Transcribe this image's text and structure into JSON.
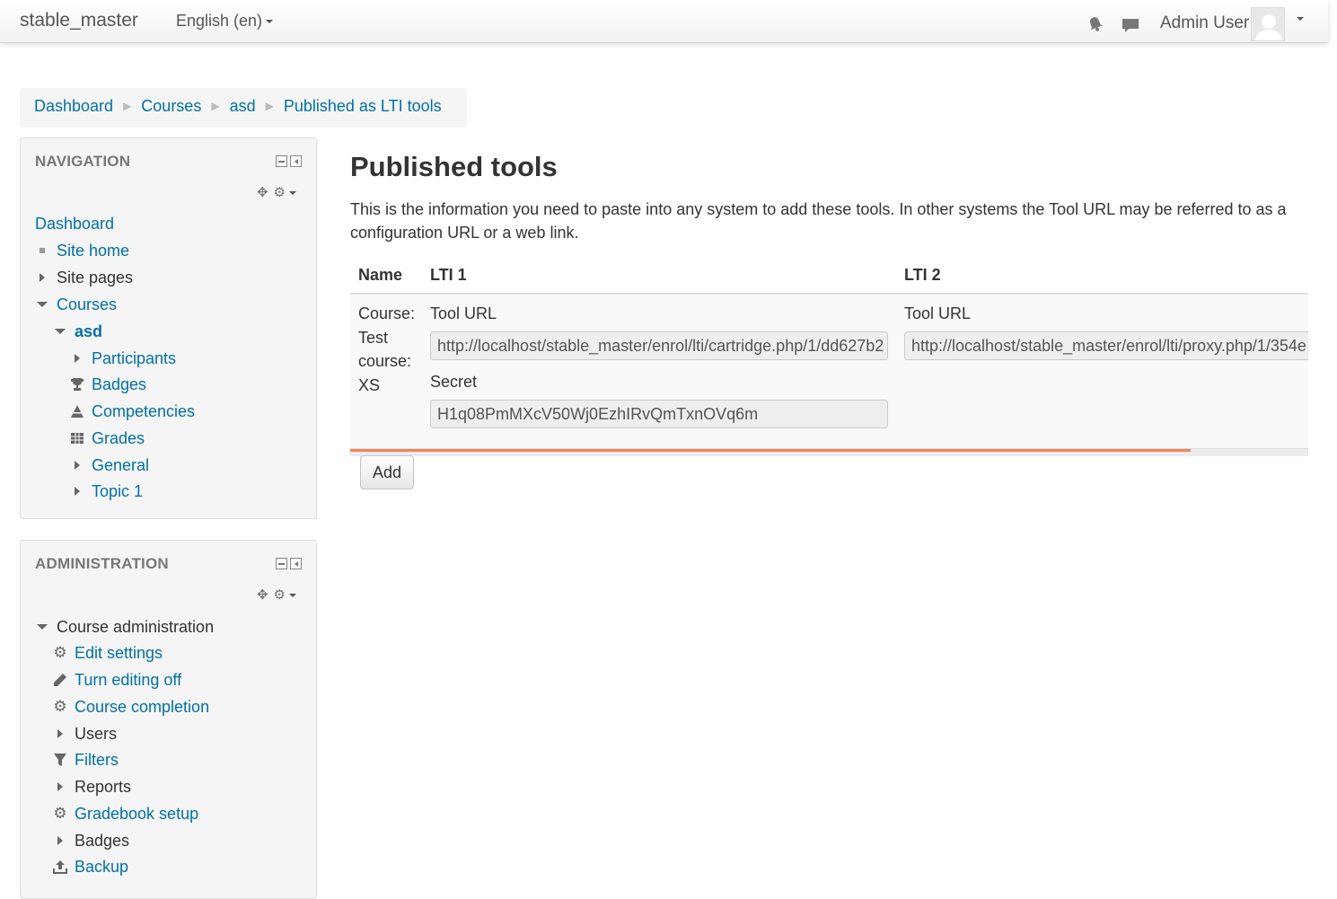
{
  "navbar": {
    "brand": "stable_master",
    "language": "English (en)",
    "username": "Admin User"
  },
  "breadcrumb": [
    "Dashboard",
    "Courses",
    "asd",
    "Published as LTI tools"
  ],
  "navigation_block": {
    "title": "NAVIGATION",
    "items": [
      {
        "label": "Dashboard",
        "icon": "none",
        "link": true
      },
      {
        "label": "Site home",
        "icon": "bullet-icon",
        "link": true
      },
      {
        "label": "Site pages",
        "icon": "expand-icon",
        "link": false
      },
      {
        "label": "Courses",
        "icon": "collapse-icon",
        "link": true
      },
      {
        "label": "asd",
        "icon": "collapse-icon",
        "link": true
      },
      {
        "label": "Participants",
        "icon": "expand-icon",
        "link": true
      },
      {
        "label": "Badges",
        "icon": "trophy-icon",
        "link": true
      },
      {
        "label": "Competencies",
        "icon": "competency-icon",
        "link": true
      },
      {
        "label": "Grades",
        "icon": "table-icon",
        "link": true
      },
      {
        "label": "General",
        "icon": "expand-icon",
        "link": true
      },
      {
        "label": "Topic 1",
        "icon": "expand-icon",
        "link": true
      }
    ]
  },
  "administration_block": {
    "title": "ADMINISTRATION",
    "items": [
      {
        "label": "Course administration",
        "icon": "collapse-icon",
        "link": false
      },
      {
        "label": "Edit settings",
        "icon": "gear-icon",
        "link": true
      },
      {
        "label": "Turn editing off",
        "icon": "pencil-icon",
        "link": true
      },
      {
        "label": "Course completion",
        "icon": "gear-icon",
        "link": true
      },
      {
        "label": "Users",
        "icon": "expand-icon",
        "link": false
      },
      {
        "label": "Filters",
        "icon": "filter-icon",
        "link": true
      },
      {
        "label": "Reports",
        "icon": "expand-icon",
        "link": false
      },
      {
        "label": "Gradebook setup",
        "icon": "gear-icon",
        "link": true
      },
      {
        "label": "Badges",
        "icon": "expand-icon",
        "link": false
      },
      {
        "label": "Backup",
        "icon": "upload-icon",
        "link": true
      }
    ]
  },
  "main": {
    "title": "Published tools",
    "intro": "This is the information you need to paste into any system to add these tools. In other systems the Tool URL may be referred to as a configuration URL or a web link.",
    "table": {
      "headers": {
        "name": "Name",
        "lti1": "LTI 1",
        "lti2": "LTI 2"
      },
      "rows": [
        {
          "name": "Course: Test course: XS",
          "lti1_tool_url_label": "Tool URL",
          "lti1_tool_url": "http://localhost/stable_master/enrol/lti/cartridge.php/1/dd627b2",
          "lti1_secret_label": "Secret",
          "lti1_secret": "H1q08PmMXcV50Wj0EzhIRvQmTxnOVq6m",
          "lti2_tool_url_label": "Tool URL",
          "lti2_tool_url": "http://localhost/stable_master/enrol/lti/proxy.php/1/354e"
        }
      ]
    },
    "add_button": "Add"
  }
}
